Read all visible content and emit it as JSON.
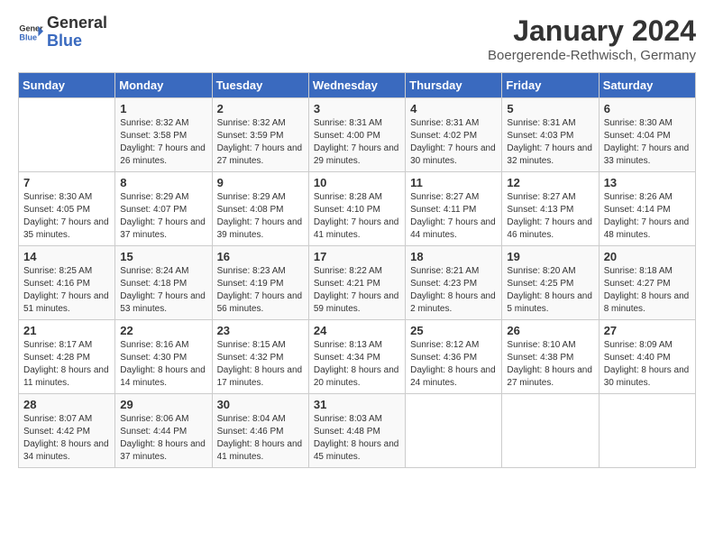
{
  "header": {
    "logo_general": "General",
    "logo_blue": "Blue",
    "month": "January 2024",
    "location": "Boergerende-Rethwisch, Germany"
  },
  "days_of_week": [
    "Sunday",
    "Monday",
    "Tuesday",
    "Wednesday",
    "Thursday",
    "Friday",
    "Saturday"
  ],
  "weeks": [
    [
      {
        "day": "",
        "sunrise": "",
        "sunset": "",
        "daylight": ""
      },
      {
        "day": "1",
        "sunrise": "Sunrise: 8:32 AM",
        "sunset": "Sunset: 3:58 PM",
        "daylight": "Daylight: 7 hours and 26 minutes."
      },
      {
        "day": "2",
        "sunrise": "Sunrise: 8:32 AM",
        "sunset": "Sunset: 3:59 PM",
        "daylight": "Daylight: 7 hours and 27 minutes."
      },
      {
        "day": "3",
        "sunrise": "Sunrise: 8:31 AM",
        "sunset": "Sunset: 4:00 PM",
        "daylight": "Daylight: 7 hours and 29 minutes."
      },
      {
        "day": "4",
        "sunrise": "Sunrise: 8:31 AM",
        "sunset": "Sunset: 4:02 PM",
        "daylight": "Daylight: 7 hours and 30 minutes."
      },
      {
        "day": "5",
        "sunrise": "Sunrise: 8:31 AM",
        "sunset": "Sunset: 4:03 PM",
        "daylight": "Daylight: 7 hours and 32 minutes."
      },
      {
        "day": "6",
        "sunrise": "Sunrise: 8:30 AM",
        "sunset": "Sunset: 4:04 PM",
        "daylight": "Daylight: 7 hours and 33 minutes."
      }
    ],
    [
      {
        "day": "7",
        "sunrise": "Sunrise: 8:30 AM",
        "sunset": "Sunset: 4:05 PM",
        "daylight": "Daylight: 7 hours and 35 minutes."
      },
      {
        "day": "8",
        "sunrise": "Sunrise: 8:29 AM",
        "sunset": "Sunset: 4:07 PM",
        "daylight": "Daylight: 7 hours and 37 minutes."
      },
      {
        "day": "9",
        "sunrise": "Sunrise: 8:29 AM",
        "sunset": "Sunset: 4:08 PM",
        "daylight": "Daylight: 7 hours and 39 minutes."
      },
      {
        "day": "10",
        "sunrise": "Sunrise: 8:28 AM",
        "sunset": "Sunset: 4:10 PM",
        "daylight": "Daylight: 7 hours and 41 minutes."
      },
      {
        "day": "11",
        "sunrise": "Sunrise: 8:27 AM",
        "sunset": "Sunset: 4:11 PM",
        "daylight": "Daylight: 7 hours and 44 minutes."
      },
      {
        "day": "12",
        "sunrise": "Sunrise: 8:27 AM",
        "sunset": "Sunset: 4:13 PM",
        "daylight": "Daylight: 7 hours and 46 minutes."
      },
      {
        "day": "13",
        "sunrise": "Sunrise: 8:26 AM",
        "sunset": "Sunset: 4:14 PM",
        "daylight": "Daylight: 7 hours and 48 minutes."
      }
    ],
    [
      {
        "day": "14",
        "sunrise": "Sunrise: 8:25 AM",
        "sunset": "Sunset: 4:16 PM",
        "daylight": "Daylight: 7 hours and 51 minutes."
      },
      {
        "day": "15",
        "sunrise": "Sunrise: 8:24 AM",
        "sunset": "Sunset: 4:18 PM",
        "daylight": "Daylight: 7 hours and 53 minutes."
      },
      {
        "day": "16",
        "sunrise": "Sunrise: 8:23 AM",
        "sunset": "Sunset: 4:19 PM",
        "daylight": "Daylight: 7 hours and 56 minutes."
      },
      {
        "day": "17",
        "sunrise": "Sunrise: 8:22 AM",
        "sunset": "Sunset: 4:21 PM",
        "daylight": "Daylight: 7 hours and 59 minutes."
      },
      {
        "day": "18",
        "sunrise": "Sunrise: 8:21 AM",
        "sunset": "Sunset: 4:23 PM",
        "daylight": "Daylight: 8 hours and 2 minutes."
      },
      {
        "day": "19",
        "sunrise": "Sunrise: 8:20 AM",
        "sunset": "Sunset: 4:25 PM",
        "daylight": "Daylight: 8 hours and 5 minutes."
      },
      {
        "day": "20",
        "sunrise": "Sunrise: 8:18 AM",
        "sunset": "Sunset: 4:27 PM",
        "daylight": "Daylight: 8 hours and 8 minutes."
      }
    ],
    [
      {
        "day": "21",
        "sunrise": "Sunrise: 8:17 AM",
        "sunset": "Sunset: 4:28 PM",
        "daylight": "Daylight: 8 hours and 11 minutes."
      },
      {
        "day": "22",
        "sunrise": "Sunrise: 8:16 AM",
        "sunset": "Sunset: 4:30 PM",
        "daylight": "Daylight: 8 hours and 14 minutes."
      },
      {
        "day": "23",
        "sunrise": "Sunrise: 8:15 AM",
        "sunset": "Sunset: 4:32 PM",
        "daylight": "Daylight: 8 hours and 17 minutes."
      },
      {
        "day": "24",
        "sunrise": "Sunrise: 8:13 AM",
        "sunset": "Sunset: 4:34 PM",
        "daylight": "Daylight: 8 hours and 20 minutes."
      },
      {
        "day": "25",
        "sunrise": "Sunrise: 8:12 AM",
        "sunset": "Sunset: 4:36 PM",
        "daylight": "Daylight: 8 hours and 24 minutes."
      },
      {
        "day": "26",
        "sunrise": "Sunrise: 8:10 AM",
        "sunset": "Sunset: 4:38 PM",
        "daylight": "Daylight: 8 hours and 27 minutes."
      },
      {
        "day": "27",
        "sunrise": "Sunrise: 8:09 AM",
        "sunset": "Sunset: 4:40 PM",
        "daylight": "Daylight: 8 hours and 30 minutes."
      }
    ],
    [
      {
        "day": "28",
        "sunrise": "Sunrise: 8:07 AM",
        "sunset": "Sunset: 4:42 PM",
        "daylight": "Daylight: 8 hours and 34 minutes."
      },
      {
        "day": "29",
        "sunrise": "Sunrise: 8:06 AM",
        "sunset": "Sunset: 4:44 PM",
        "daylight": "Daylight: 8 hours and 37 minutes."
      },
      {
        "day": "30",
        "sunrise": "Sunrise: 8:04 AM",
        "sunset": "Sunset: 4:46 PM",
        "daylight": "Daylight: 8 hours and 41 minutes."
      },
      {
        "day": "31",
        "sunrise": "Sunrise: 8:03 AM",
        "sunset": "Sunset: 4:48 PM",
        "daylight": "Daylight: 8 hours and 45 minutes."
      },
      {
        "day": "",
        "sunrise": "",
        "sunset": "",
        "daylight": ""
      },
      {
        "day": "",
        "sunrise": "",
        "sunset": "",
        "daylight": ""
      },
      {
        "day": "",
        "sunrise": "",
        "sunset": "",
        "daylight": ""
      }
    ]
  ]
}
